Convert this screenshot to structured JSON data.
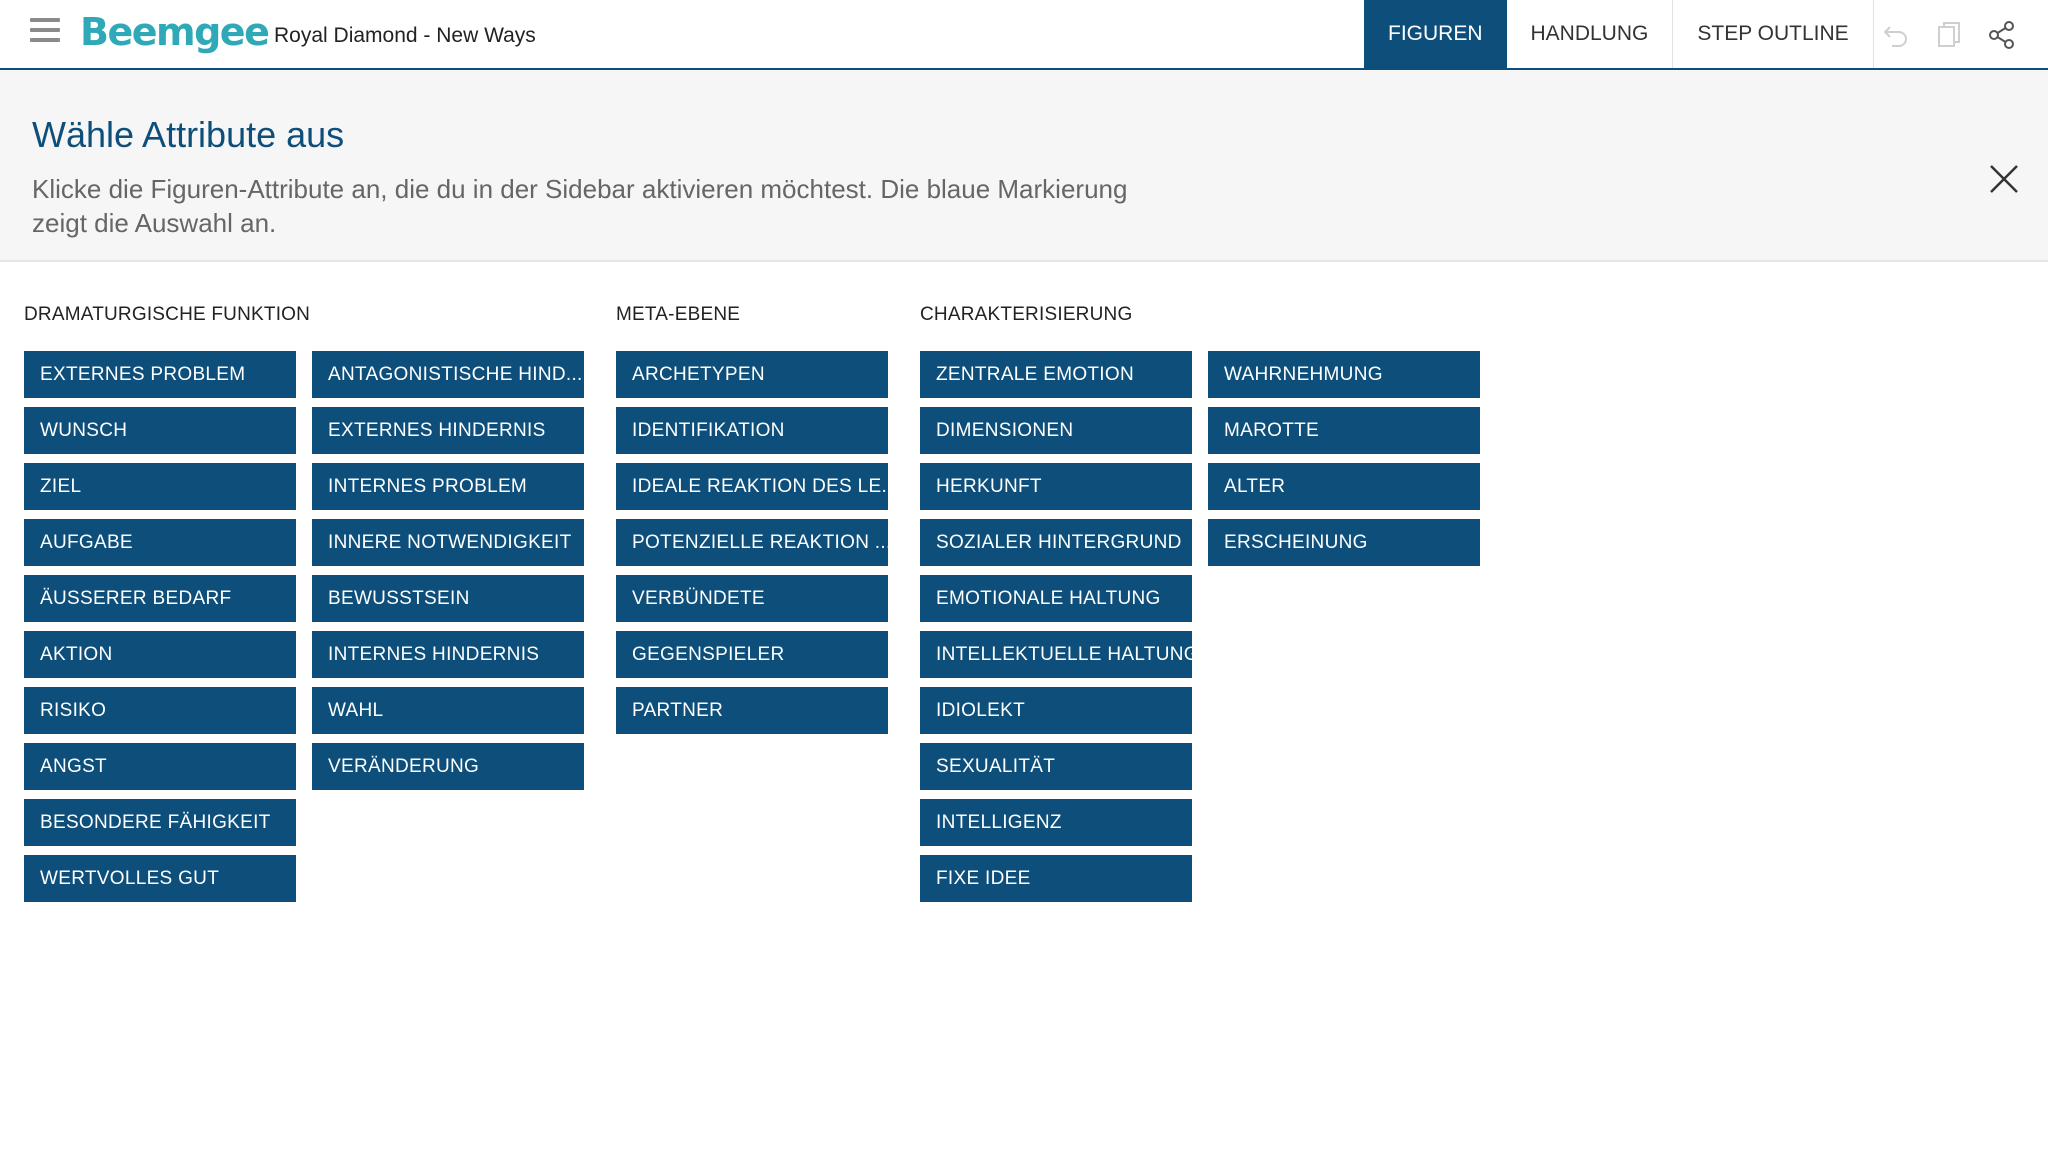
{
  "app": {
    "logo": "Beemgee",
    "project_title": "Royal Diamond - New Ways"
  },
  "tabs": [
    {
      "label": "FIGUREN",
      "active": true
    },
    {
      "label": "HANDLUNG",
      "active": false
    },
    {
      "label": "STEP OUTLINE",
      "active": false
    }
  ],
  "toolbar": {
    "icons": [
      "undo-icon",
      "copy-icon",
      "share-icon"
    ]
  },
  "panel": {
    "title": "Wähle Attribute aus",
    "description": "Klicke die Figuren-Attribute an, die du in der Sidebar aktivieren möchtest. Die blaue Markierung zeigt die Auswahl an."
  },
  "colors": {
    "accent": "#0d4f7a",
    "logo": "#2fa9b7"
  },
  "groups": [
    {
      "heading": "DRAMATURGISCHE FUNKTION",
      "columns": [
        [
          "EXTERNES PROBLEM",
          "WUNSCH",
          "ZIEL",
          "AUFGABE",
          "ÄUSSERER BEDARF",
          "AKTION",
          "RISIKO",
          "ANGST",
          "BESONDERE FÄHIGKEIT",
          "WERTVOLLES GUT"
        ],
        [
          "ANTAGONISTISCHE HIND...",
          "EXTERNES HINDERNIS",
          "INTERNES PROBLEM",
          "INNERE NOTWENDIGKEIT",
          "BEWUSSTSEIN",
          "INTERNES HINDERNIS",
          "WAHL",
          "VERÄNDERUNG"
        ]
      ]
    },
    {
      "heading": "META-EBENE",
      "columns": [
        [
          "ARCHETYPEN",
          "IDENTIFIKATION",
          "IDEALE REAKTION DES LE...",
          "POTENZIELLE REAKTION ...",
          "VERBÜNDETE",
          "GEGENSPIELER",
          "PARTNER"
        ]
      ]
    },
    {
      "heading": "CHARAKTERISIERUNG",
      "columns": [
        [
          "ZENTRALE EMOTION",
          "DIMENSIONEN",
          "HERKUNFT",
          "SOZIALER HINTERGRUND",
          "EMOTIONALE HALTUNG",
          "INTELLEKTUELLE HALTUNG",
          "IDIOLEKT",
          "SEXUALITÄT",
          "INTELLIGENZ",
          "FIXE IDEE"
        ],
        [
          "WAHRNEHMUNG",
          "MAROTTE",
          "ALTER",
          "ERSCHEINUNG"
        ]
      ]
    }
  ]
}
